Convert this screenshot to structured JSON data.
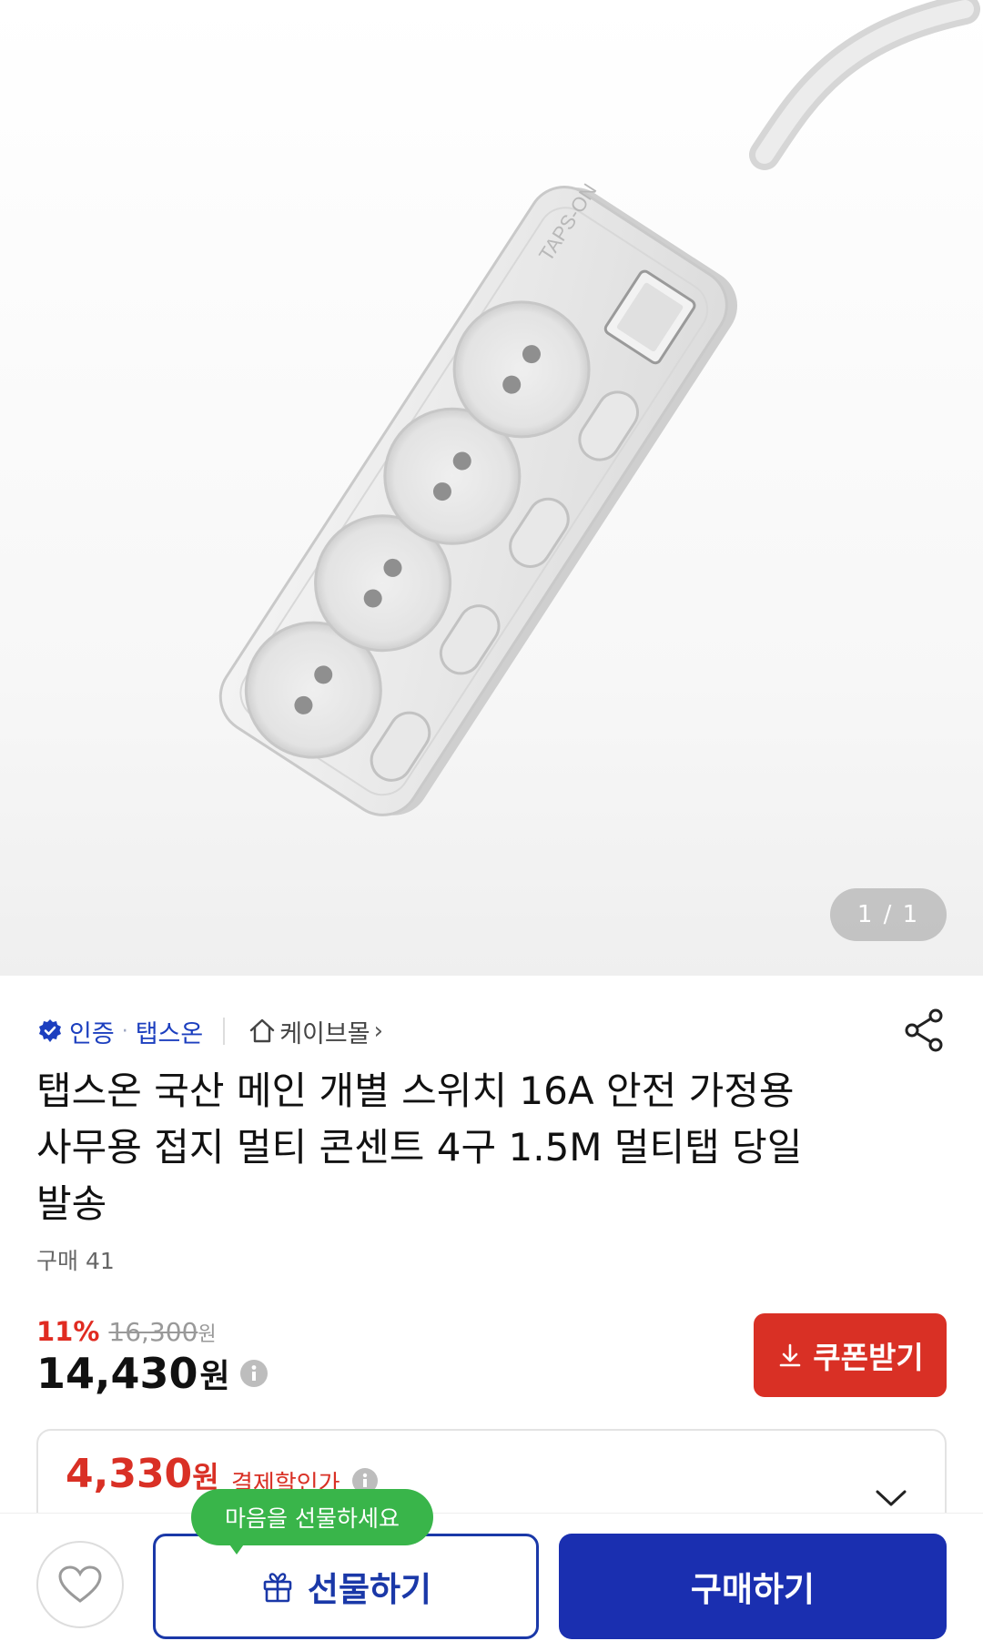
{
  "gallery": {
    "counter": "1 / 1",
    "product_brand_print": "TAPS-ON"
  },
  "meta": {
    "verified_label": "인증",
    "brand": "탭스온",
    "mall": "케이브몰",
    "mall_chevron": "›"
  },
  "product": {
    "title_line1": "탭스온 국산 메인 개별 스위치 16A 안전 가정용",
    "title_line2": "사무용 접지 멀티 콘센트 4구 1.5M 멀티탭 당일",
    "title_line3": "발송",
    "purchases": "구매 41"
  },
  "pricing": {
    "discount": "11%",
    "original_price": "16,300",
    "original_unit": "원",
    "price": "14,430",
    "price_unit": "원",
    "coupon_label": "쿠폰받기"
  },
  "payment_discount": {
    "amount": "4,330",
    "unit": "원",
    "label": "결제할인가"
  },
  "bottom": {
    "tooltip": "마음을 선물하세요",
    "gift_label": "선물하기",
    "buy_label": "구매하기"
  },
  "colors": {
    "accent_blue": "#1a2fb0",
    "accent_red": "#d93025",
    "tooltip_green": "#39b54a"
  }
}
